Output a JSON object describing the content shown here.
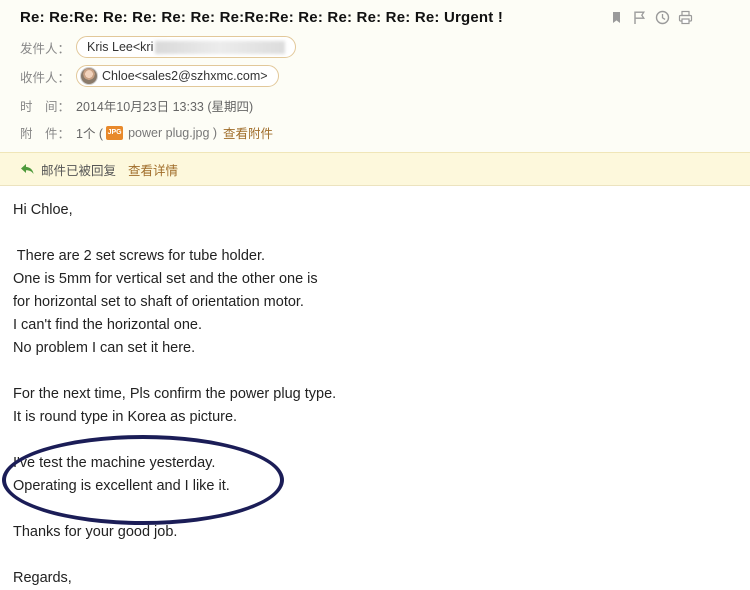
{
  "subject": "Re: Re:Re: Re: Re: Re: Re: Re:Re:Re: Re: Re: Re: Re: Re: Urgent !",
  "actions": [
    {
      "name": "bookmark-icon"
    },
    {
      "name": "flag-icon"
    },
    {
      "name": "clock-icon"
    },
    {
      "name": "print-icon"
    }
  ],
  "sender": {
    "label": "发件人：",
    "name": "Kris Lee<kri"
  },
  "recipient": {
    "label": "收件人：",
    "name": "Chloe",
    "email": "<sales2@szhxmc.com>"
  },
  "time": {
    "label": "时　间：",
    "value": "2014年10月23日 13:33 (星期四)"
  },
  "attachment": {
    "label": "附　件：",
    "count": "1个 (",
    "icon_text": "JPG",
    "filename": "power plug.jpg )",
    "view_link": "查看附件"
  },
  "notice": {
    "text": "邮件已被回复",
    "detail_link": "查看详情"
  },
  "body_lines": [
    "Hi Chloe,",
    "",
    " There are 2 set screws for tube holder.",
    "One is 5mm for vertical set and the other one is",
    "for horizontal set to shaft of orientation motor.",
    "I can't find the horizontal one.",
    "No problem I can set it here.",
    "",
    "For the next time, Pls confirm the power plug type.",
    "It is round type in Korea as picture.",
    "",
    "I've test the machine yesterday.",
    "Operating is excellent and I like it.",
    "",
    "Thanks for your good job.",
    "",
    "Regards,"
  ],
  "colors": {
    "accent_link": "#a06d2a",
    "notice_bg": "#fdf8dc",
    "circle_mark": "#1b1d57"
  }
}
